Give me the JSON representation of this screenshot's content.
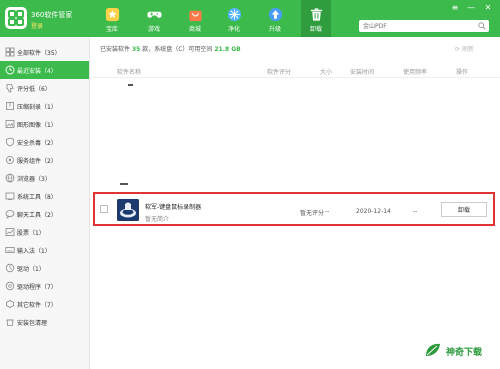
{
  "app": {
    "title": "360软件管家",
    "login_label": "登录"
  },
  "nav": [
    {
      "label": "宝库",
      "icon": "star-icon"
    },
    {
      "label": "游戏",
      "icon": "gamepad-icon"
    },
    {
      "label": "商城",
      "icon": "shopping-bag-icon"
    },
    {
      "label": "净化",
      "icon": "purify-icon"
    },
    {
      "label": "升级",
      "icon": "upgrade-arrow-icon"
    },
    {
      "label": "卸载",
      "icon": "trash-icon"
    }
  ],
  "active_nav": "卸载",
  "search": {
    "placeholder": "金山PDF"
  },
  "window_controls": [
    "≡",
    "—",
    "✕"
  ],
  "sidebar": [
    {
      "label": "全部软件（35）",
      "icon": "grid-icon",
      "active": false
    },
    {
      "label": "最近安装（4）",
      "icon": "clock-icon",
      "active": true
    },
    {
      "label": "评分低（6）",
      "icon": "thumb-down-icon",
      "active": false
    },
    {
      "label": "压缩刻录（1）",
      "icon": "archive-icon",
      "active": false
    },
    {
      "label": "图形图像（1）",
      "icon": "image-icon",
      "active": false
    },
    {
      "label": "安全杀毒（2）",
      "icon": "shield-icon",
      "active": false
    },
    {
      "label": "服务组件（2）",
      "icon": "component-icon",
      "active": false
    },
    {
      "label": "浏览器（3）",
      "icon": "browser-icon",
      "active": false
    },
    {
      "label": "系统工具（8）",
      "icon": "tools-icon",
      "active": false
    },
    {
      "label": "聊天工具（2）",
      "icon": "chat-icon",
      "active": false
    },
    {
      "label": "股票（1）",
      "icon": "stock-icon",
      "active": false
    },
    {
      "label": "输入法（1）",
      "icon": "keyboard-icon",
      "active": false
    },
    {
      "label": "驱动（1）",
      "icon": "driver-icon",
      "active": false
    },
    {
      "label": "驱动程序（7）",
      "icon": "driver-program-icon",
      "active": false
    },
    {
      "label": "其它软件（7）",
      "icon": "other-icon",
      "active": false
    },
    {
      "label": "安装包清理",
      "icon": "cleanup-icon",
      "active": false
    }
  ],
  "info": {
    "prefix": "已安装软件",
    "count": "35",
    "middle": "款，系统盘（C）可用空间",
    "free_space": "21.8 GB"
  },
  "refresh_label": "刷新",
  "columns": [
    "软件名称",
    "软件评分",
    "大小",
    "安装时间",
    "使用频率",
    "操作"
  ],
  "row": {
    "name": "软军-键盘鼠标录制器",
    "intro": "暂无简介",
    "score": "暂无评分",
    "size": "--",
    "install_date": "2020-12-14",
    "frequency": "--",
    "action": "卸载"
  },
  "watermark": "神奇下载",
  "colors": {
    "brand_green": "#3dba4c",
    "highlight_red": "#e03333",
    "login_yellow": "#ffe66b"
  }
}
